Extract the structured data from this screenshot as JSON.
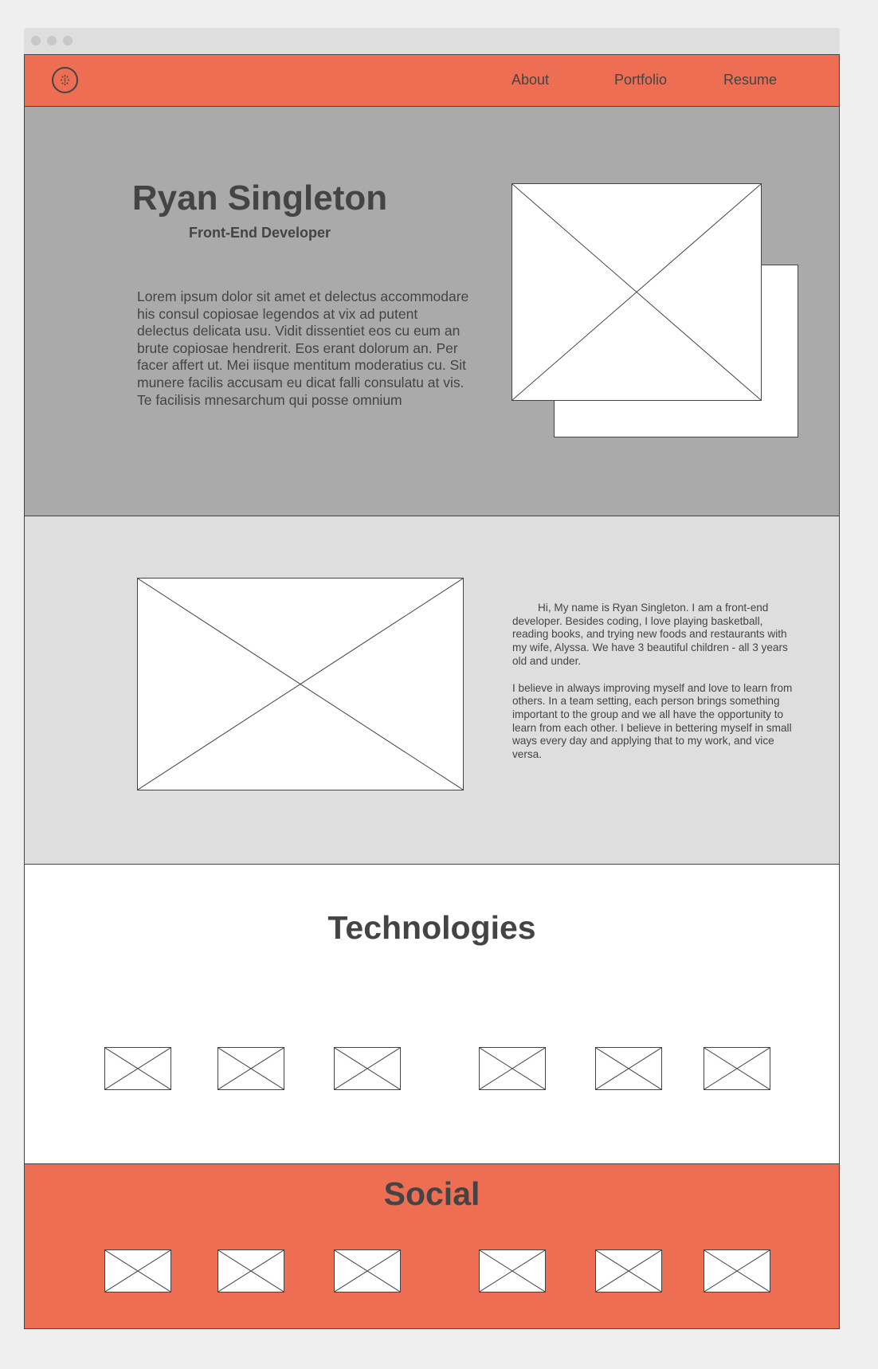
{
  "nav": {
    "logo_icon": "dribbble-icon",
    "links": [
      "About",
      "Portfolio",
      "Resume"
    ]
  },
  "hero": {
    "name": "Ryan Singleton",
    "role": "Front-End Developer",
    "text": "Lorem ipsum dolor sit amet et delectus accommodare his consul copiosae legendos at vix ad putent delectus delicata usu. Vidit dissentiet eos cu eum an brute copiosae hendrerit. Eos erant dolorum an. Per facer affert ut. Mei iisque mentitum moderatius cu. Sit munere facilis accusam eu dicat falli consulatu at vis. Te facilisis mnesarchum qui posse omnium"
  },
  "about": {
    "paragraph1": "Hi, My name is Ryan Singleton. I am a front-end developer. Besides coding, I love playing basketball, reading books, and trying new foods and restaurants with my wife, Alyssa. We have 3 beautiful children - all 3 years old and under.",
    "paragraph2": "I believe in always improving myself and love to learn from others. In a team setting, each person brings something important to the group and we all have the opportunity to learn from each other. I believe in bettering myself in small ways every day and applying that to my work, and vice versa."
  },
  "technologies": {
    "title": "Technologies"
  },
  "social": {
    "title": "Social"
  },
  "colors": {
    "accent": "#ee6e53",
    "hero_bg": "#aaaaaa",
    "about_bg": "#dedede",
    "text": "#444444"
  }
}
